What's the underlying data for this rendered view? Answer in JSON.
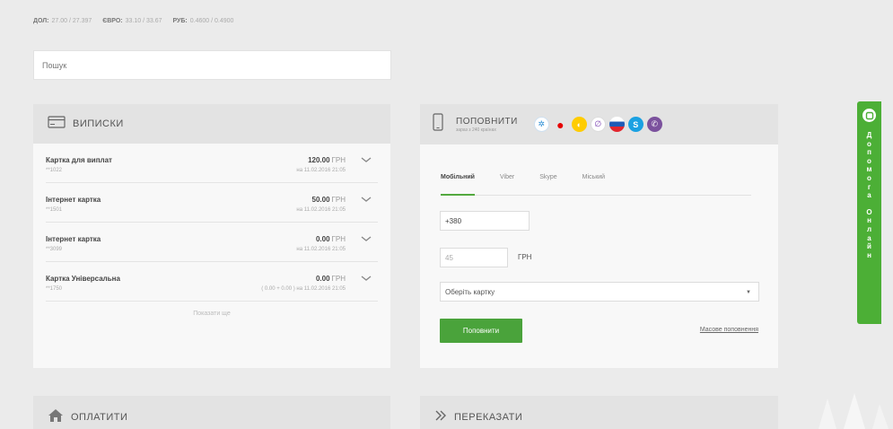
{
  "rates": {
    "usd_label": "ДОЛ:",
    "usd_value": "27.00 / 27.397",
    "eur_label": "ЄВРО:",
    "eur_value": "33.10 / 33.67",
    "rub_label": "РУБ:",
    "rub_value": "0.4600 / 0.4900"
  },
  "search": {
    "placeholder": "Пошук"
  },
  "statements": {
    "title": "ВИПИСКИ",
    "rows": [
      {
        "name": "Картка для виплат",
        "number": "**1022",
        "amount": "120.00",
        "currency": "ГРН",
        "date": "на 11.02.2016 21:05"
      },
      {
        "name": "Інтернет картка",
        "number": "**1501",
        "amount": "50.00",
        "currency": "ГРН",
        "date": "на 11.02.2016 21:05"
      },
      {
        "name": "Інтернет картка",
        "number": "**3099",
        "amount": "0.00",
        "currency": "ГРН",
        "date": "на 11.02.2016 21:05"
      },
      {
        "name": "Картка Універсальна",
        "number": "**1750",
        "amount": "0.00",
        "currency": "ГРН",
        "date": "( 0.00 + 0.00 ) на 11.02.2016 21:05"
      }
    ],
    "show_all": "Показати ще"
  },
  "topup": {
    "title": "ПОПОВНИТИ",
    "subtitle": "зараз з 240 країнах",
    "operators": [
      "kyivstar-icon",
      "vodafone-icon",
      "lifecell-icon",
      "intertelecom-icon",
      "mts-icon",
      "skype-icon",
      "viber-icon"
    ],
    "tabs": [
      "Мобільний",
      "Viber",
      "Skype",
      "Міський"
    ],
    "phone_value": "+380",
    "amount_value": "45",
    "amount_currency": "ГРН",
    "card_select": "Оберіть картку",
    "submit_label": "Поповнити",
    "mass_link": "Масове поповнення"
  },
  "pay": {
    "title": "ОПЛАТИТИ"
  },
  "transfer": {
    "title": "ПЕРЕКАЗАТИ"
  },
  "help": {
    "letters": [
      "Д",
      "о",
      "п",
      "о",
      "м",
      "о",
      "г",
      "а",
      "",
      "О",
      "н",
      "л",
      "а",
      "й",
      "н"
    ]
  },
  "colors": {
    "accent": "#4aa33b",
    "panel_header": "#e3e3e3",
    "background": "#ebebeb"
  }
}
